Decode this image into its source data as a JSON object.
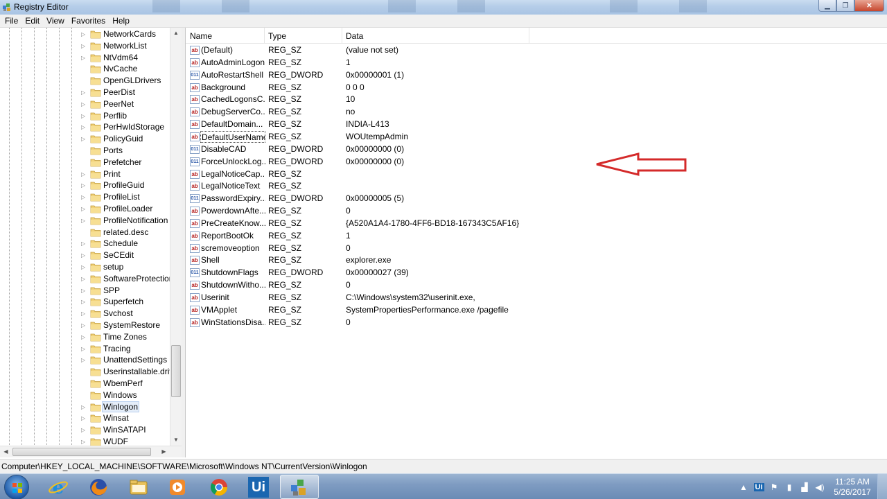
{
  "window": {
    "title": "Registry Editor"
  },
  "menu": [
    "File",
    "Edit",
    "View",
    "Favorites",
    "Help"
  ],
  "tree": {
    "items": [
      {
        "label": "NetworkCards",
        "expandable": true
      },
      {
        "label": "NetworkList",
        "expandable": true
      },
      {
        "label": "NtVdm64",
        "expandable": true
      },
      {
        "label": "NvCache",
        "expandable": false
      },
      {
        "label": "OpenGLDrivers",
        "expandable": false
      },
      {
        "label": "PeerDist",
        "expandable": true
      },
      {
        "label": "PeerNet",
        "expandable": true
      },
      {
        "label": "Perflib",
        "expandable": true
      },
      {
        "label": "PerHwIdStorage",
        "expandable": true
      },
      {
        "label": "PolicyGuid",
        "expandable": true
      },
      {
        "label": "Ports",
        "expandable": false
      },
      {
        "label": "Prefetcher",
        "expandable": false
      },
      {
        "label": "Print",
        "expandable": true
      },
      {
        "label": "ProfileGuid",
        "expandable": true
      },
      {
        "label": "ProfileList",
        "expandable": true
      },
      {
        "label": "ProfileLoader",
        "expandable": true
      },
      {
        "label": "ProfileNotification",
        "expandable": true
      },
      {
        "label": "related.desc",
        "expandable": false
      },
      {
        "label": "Schedule",
        "expandable": true
      },
      {
        "label": "SeCEdit",
        "expandable": true
      },
      {
        "label": "setup",
        "expandable": true
      },
      {
        "label": "SoftwareProtectionPlatform",
        "expandable": true
      },
      {
        "label": "SPP",
        "expandable": true
      },
      {
        "label": "Superfetch",
        "expandable": true
      },
      {
        "label": "Svchost",
        "expandable": true
      },
      {
        "label": "SystemRestore",
        "expandable": true
      },
      {
        "label": "Time Zones",
        "expandable": true
      },
      {
        "label": "Tracing",
        "expandable": true
      },
      {
        "label": "UnattendSettings",
        "expandable": true
      },
      {
        "label": "Userinstallable.drivers",
        "expandable": false
      },
      {
        "label": "WbemPerf",
        "expandable": false
      },
      {
        "label": "Windows",
        "expandable": false
      },
      {
        "label": "Winlogon",
        "expandable": true,
        "selected": true
      },
      {
        "label": "Winsat",
        "expandable": true
      },
      {
        "label": "WinSATAPI",
        "expandable": true
      },
      {
        "label": "WUDF",
        "expandable": true
      }
    ]
  },
  "columns": {
    "name": "Name",
    "type": "Type",
    "data": "Data"
  },
  "rows": [
    {
      "name": "(Default)",
      "type": "REG_SZ",
      "data": "(value not set)",
      "kind": "sz"
    },
    {
      "name": "AutoAdminLogon",
      "type": "REG_SZ",
      "data": "1",
      "kind": "sz"
    },
    {
      "name": "AutoRestartShell",
      "type": "REG_DWORD",
      "data": "0x00000001 (1)",
      "kind": "dword"
    },
    {
      "name": "Background",
      "type": "REG_SZ",
      "data": "0 0 0",
      "kind": "sz"
    },
    {
      "name": "CachedLogonsC...",
      "type": "REG_SZ",
      "data": "10",
      "kind": "sz"
    },
    {
      "name": "DebugServerCo...",
      "type": "REG_SZ",
      "data": "no",
      "kind": "sz"
    },
    {
      "name": "DefaultDomain...",
      "type": "REG_SZ",
      "data": "INDIA-L413",
      "kind": "sz"
    },
    {
      "name": "DefaultUserName",
      "type": "REG_SZ",
      "data": "WOUtempAdmin",
      "kind": "sz",
      "focused": true
    },
    {
      "name": "DisableCAD",
      "type": "REG_DWORD",
      "data": "0x00000000 (0)",
      "kind": "dword"
    },
    {
      "name": "ForceUnlockLog...",
      "type": "REG_DWORD",
      "data": "0x00000000 (0)",
      "kind": "dword"
    },
    {
      "name": "LegalNoticeCap...",
      "type": "REG_SZ",
      "data": "",
      "kind": "sz"
    },
    {
      "name": "LegalNoticeText",
      "type": "REG_SZ",
      "data": "",
      "kind": "sz"
    },
    {
      "name": "PasswordExpiry...",
      "type": "REG_DWORD",
      "data": "0x00000005 (5)",
      "kind": "dword"
    },
    {
      "name": "PowerdownAfte...",
      "type": "REG_SZ",
      "data": "0",
      "kind": "sz"
    },
    {
      "name": "PreCreateKnow...",
      "type": "REG_SZ",
      "data": "{A520A1A4-1780-4FF6-BD18-167343C5AF16}",
      "kind": "sz"
    },
    {
      "name": "ReportBootOk",
      "type": "REG_SZ",
      "data": "1",
      "kind": "sz"
    },
    {
      "name": "scremoveoption",
      "type": "REG_SZ",
      "data": "0",
      "kind": "sz"
    },
    {
      "name": "Shell",
      "type": "REG_SZ",
      "data": "explorer.exe",
      "kind": "sz"
    },
    {
      "name": "ShutdownFlags",
      "type": "REG_DWORD",
      "data": "0x00000027 (39)",
      "kind": "dword"
    },
    {
      "name": "ShutdownWitho...",
      "type": "REG_SZ",
      "data": "0",
      "kind": "sz"
    },
    {
      "name": "Userinit",
      "type": "REG_SZ",
      "data": "C:\\Windows\\system32\\userinit.exe,",
      "kind": "sz"
    },
    {
      "name": "VMApplet",
      "type": "REG_SZ",
      "data": "SystemPropertiesPerformance.exe /pagefile",
      "kind": "sz"
    },
    {
      "name": "WinStationsDisa...",
      "type": "REG_SZ",
      "data": "0",
      "kind": "sz"
    }
  ],
  "status": "Computer\\HKEY_LOCAL_MACHINE\\SOFTWARE\\Microsoft\\Windows NT\\CurrentVersion\\Winlogon",
  "taskbar": {
    "apps": [
      {
        "name": "internet-explorer-icon"
      },
      {
        "name": "firefox-icon"
      },
      {
        "name": "file-explorer-icon"
      },
      {
        "name": "media-player-icon"
      },
      {
        "name": "chrome-icon"
      },
      {
        "name": "uipath-icon",
        "text": "Ui"
      },
      {
        "name": "registry-editor-icon",
        "active": true
      }
    ],
    "tray_ui": "Ui",
    "time": "11:25 AM",
    "date": "5/26/2017"
  },
  "colors": {
    "arrow": "#d42a2a",
    "taskbar": "#7f9cc2",
    "selection": "#e5eef9"
  }
}
